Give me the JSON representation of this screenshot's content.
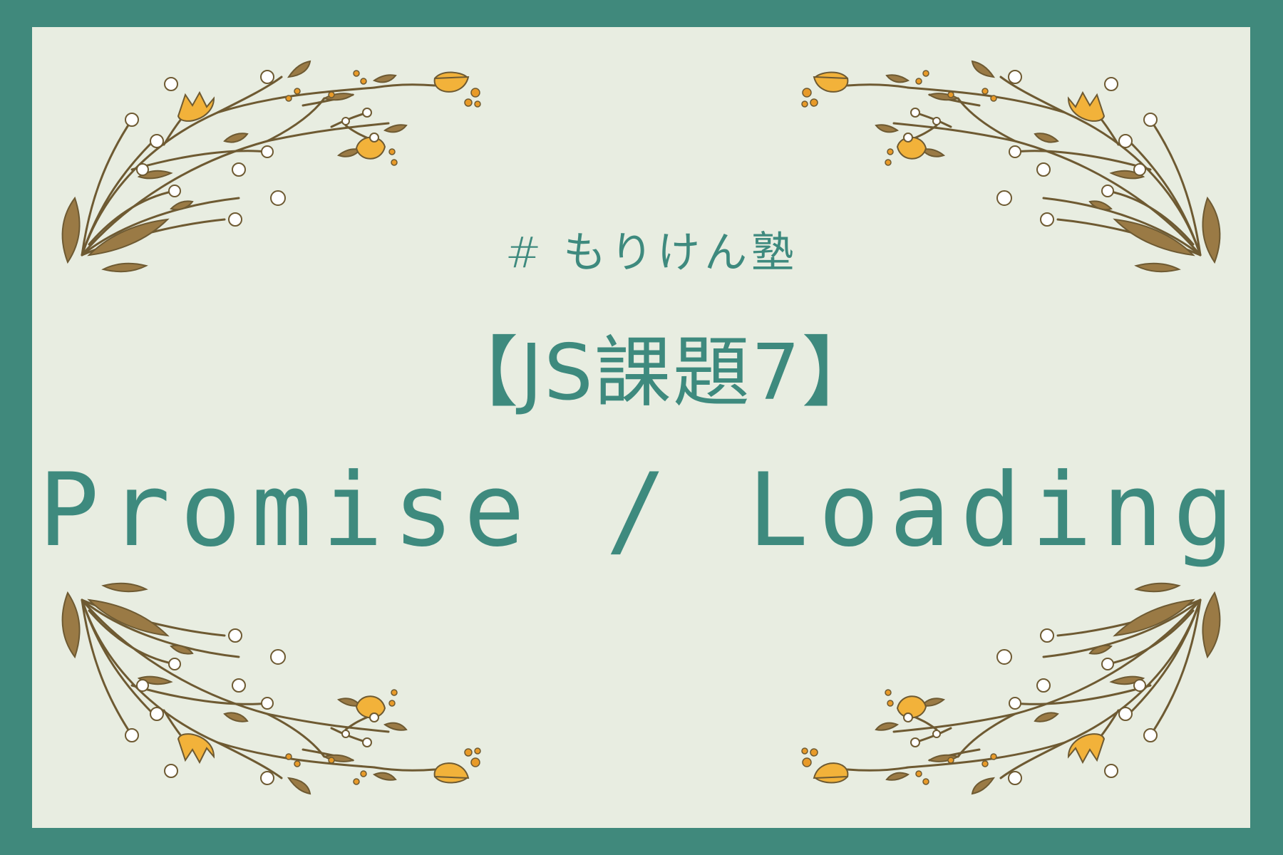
{
  "card": {
    "hashtag": "# もりけん塾",
    "heading": "【JS課題7】",
    "subtitle": "Promise / Loading"
  },
  "decoration": {
    "icon": "floral-branch-icon",
    "colors": {
      "background": "#40897c",
      "card": "#e8ede1",
      "text": "#3e8a7e",
      "stem": "#6e5a32",
      "leaf": "#9a7a45",
      "flower": "#f2b23a",
      "berry": "#e89a28",
      "bud": "#ffffff"
    }
  }
}
